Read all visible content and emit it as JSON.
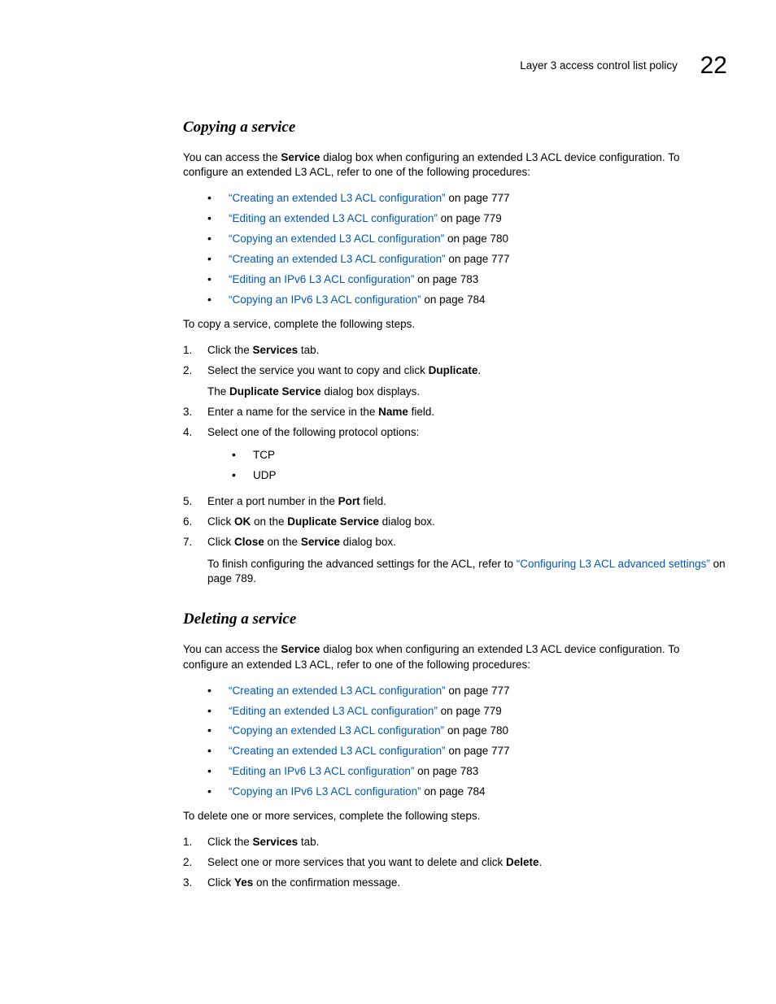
{
  "header": {
    "running_title": "Layer 3 access control list policy",
    "chapter_number": "22"
  },
  "section1": {
    "heading": "Copying a service",
    "intro_pre": "You can access the ",
    "intro_bold": "Service",
    "intro_post": " dialog box when configuring an extended L3 ACL device configuration. To configure an extended L3 ACL, refer to one of the following procedures:",
    "links": [
      {
        "text": "“Creating an extended L3 ACL configuration”",
        "suffix": " on page 777"
      },
      {
        "text": "“Editing an extended L3 ACL configuration”",
        "suffix": " on page 779"
      },
      {
        "text": "“Copying an extended L3 ACL configuration”",
        "suffix": " on page 780"
      },
      {
        "text": "“Creating an extended L3 ACL configuration”",
        "suffix": " on page 777"
      },
      {
        "text": "“Editing an IPv6 L3 ACL configuration”",
        "suffix": " on page 783"
      },
      {
        "text": "“Copying an IPv6 L3 ACL configuration”",
        "suffix": " on page 784"
      }
    ],
    "lead_in": "To copy a service, complete the following steps.",
    "steps": {
      "s1_pre": "Click the ",
      "s1_bold": "Services",
      "s1_post": " tab.",
      "s2_pre": "Select the service you want to copy and click ",
      "s2_bold": "Duplicate",
      "s2_post": ".",
      "s2_body_pre": "The ",
      "s2_body_bold": "Duplicate Service",
      "s2_body_post": " dialog box displays.",
      "s3_pre": "Enter a name for the service in the ",
      "s3_bold": "Name",
      "s3_post": " field.",
      "s4": "Select one of the following protocol options:",
      "s4_opts": [
        "TCP",
        "UDP"
      ],
      "s5_pre": "Enter a port number in the ",
      "s5_bold": "Port",
      "s5_post": " field.",
      "s6_pre": "Click ",
      "s6_bold1": "OK",
      "s6_mid": " on the ",
      "s6_bold2": "Duplicate Service",
      "s6_post": " dialog box.",
      "s7_pre": "Click ",
      "s7_bold1": "Close",
      "s7_mid": " on the ",
      "s7_bold2": "Service",
      "s7_post": " dialog box.",
      "s7_body_pre": "To finish configuring the advanced settings for the ACL, refer to ",
      "s7_body_link": "“Configuring L3 ACL advanced settings”",
      "s7_body_post": " on page 789."
    }
  },
  "section2": {
    "heading": "Deleting a service",
    "intro_pre": "You can access the ",
    "intro_bold": "Service",
    "intro_post": " dialog box when configuring an extended L3 ACL device configuration. To configure an extended L3 ACL, refer to one of the following procedures:",
    "links": [
      {
        "text": "“Creating an extended L3 ACL configuration”",
        "suffix": " on page 777"
      },
      {
        "text": "“Editing an extended L3 ACL configuration”",
        "suffix": " on page 779"
      },
      {
        "text": "“Copying an extended L3 ACL configuration”",
        "suffix": " on page 780"
      },
      {
        "text": "“Creating an extended L3 ACL configuration”",
        "suffix": " on page 777"
      },
      {
        "text": "“Editing an IPv6 L3 ACL configuration”",
        "suffix": " on page 783"
      },
      {
        "text": "“Copying an IPv6 L3 ACL configuration”",
        "suffix": " on page 784"
      }
    ],
    "lead_in": "To delete one or more services, complete the following steps.",
    "steps": {
      "s1_pre": "Click the ",
      "s1_bold": "Services",
      "s1_post": " tab.",
      "s2_pre": "Select one or more services that you want to delete and click ",
      "s2_bold": "Delete",
      "s2_post": ".",
      "s3_pre": "Click ",
      "s3_bold": "Yes",
      "s3_post": " on the confirmation message."
    }
  }
}
